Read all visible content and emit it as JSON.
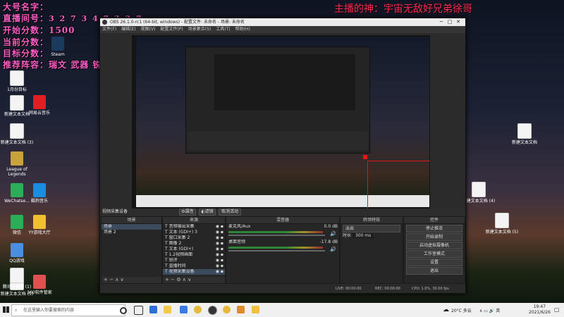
{
  "overlay": {
    "lines": [
      {
        "label": "大号名字：",
        "value": ""
      },
      {
        "label": "直播间号：",
        "value": "3 2 7 3 4 7 3 2 7"
      },
      {
        "label": "开始分数：",
        "value": "1500"
      },
      {
        "label": "当前分数：",
        "value": ""
      },
      {
        "label": "目标分数：",
        "value": ""
      },
      {
        "label": "推荐阵容：",
        "value": "瑞文 武器 锐钛 换形"
      }
    ],
    "top_banner": "主播的神：宇宙无敌好兄弟徐哥"
  },
  "desktop": {
    "icons_left": [
      {
        "label": "1月份目标",
        "kind": "doc"
      },
      {
        "label": "新建文本文档",
        "kind": "doc"
      },
      {
        "label": "网易云音乐",
        "kind": "app",
        "color": "#e02020"
      },
      {
        "label": "新建文本文档 (3)",
        "kind": "doc"
      },
      {
        "label": "League of Legends",
        "kind": "app",
        "color": "#c8a23a"
      },
      {
        "label": "WeChatse...",
        "kind": "app",
        "color": "#2aae57"
      },
      {
        "label": "酷狗音乐",
        "kind": "app",
        "color": "#1b8de0"
      },
      {
        "label": "微信",
        "kind": "app",
        "color": "#2aae57"
      },
      {
        "label": "YY游戏大厅",
        "kind": "app",
        "color": "#f0c030"
      },
      {
        "label": "QQ游戏",
        "kind": "app",
        "color": "#4a8ee0"
      },
      {
        "label": "新建文本文档 (5)",
        "kind": "doc"
      },
      {
        "label": "腾讯儿童网 (1)",
        "kind": "doc"
      },
      {
        "label": "360软件管家",
        "kind": "app",
        "color": "#e05050"
      },
      {
        "label": "Steam",
        "kind": "app",
        "color": "#1b3a5c"
      }
    ],
    "icons_right": [
      {
        "label": "新建文本文档",
        "kind": "doc"
      },
      {
        "label": "新建文本文档 (4)",
        "kind": "doc"
      },
      {
        "label": "新建文本文档 (5)",
        "kind": "doc"
      }
    ]
  },
  "obs": {
    "title": "OBS 26.1.0-rc1 (64-bit, windows) - 配置文件: 未命名 - 场景: 未命名",
    "menu": [
      "文件(F)",
      "编辑(E)",
      "视图(V)",
      "配置文件(P)",
      "场景集合(S)",
      "工具(T)",
      "帮助(H)"
    ],
    "scene_label": "视频采集设备",
    "scene_buttons": [
      "属性",
      "滤镜",
      "取消活动"
    ],
    "panels": {
      "scenes": {
        "title": "场景",
        "items": [
          "场景",
          "场景 2"
        ]
      },
      "sources": {
        "title": "来源",
        "items": [
          "音频输出采集",
          "文本 (GDI+) 3",
          "窗口采集 2",
          "图像 2",
          "文本 (GDI+)",
          "1.2视频画面",
          "锐评",
          "直播时间",
          "视频采集设备"
        ]
      },
      "mixer": {
        "title": "混音器",
        "tracks": [
          {
            "name": "麦克风/Aux",
            "value": "0.0 dB"
          },
          {
            "name": "桌面音频",
            "value": "-17.8 dB"
          }
        ]
      },
      "transitions": {
        "title": "转场特效",
        "type": "淡出",
        "duration_label": "时长",
        "duration": "300 ms"
      },
      "controls": {
        "title": "控件",
        "buttons": [
          "停止推流",
          "开始录制",
          "启动虚拟摄像机",
          "工作室模式",
          "设置",
          "退出"
        ]
      }
    },
    "status": {
      "live": "LIVE: 00:00:00",
      "rec": "REC: 00:00:00",
      "cpu": "CPU: 1.0%, 30.00 fps"
    }
  },
  "taskbar": {
    "search_placeholder": "在这里输入你要搜索的内容",
    "weather": "20°C 多云",
    "time": "19:47",
    "date": "2021/6/26"
  },
  "colors": {
    "accent_red": "#e01818",
    "overlay_text": "#ff5ec8"
  }
}
